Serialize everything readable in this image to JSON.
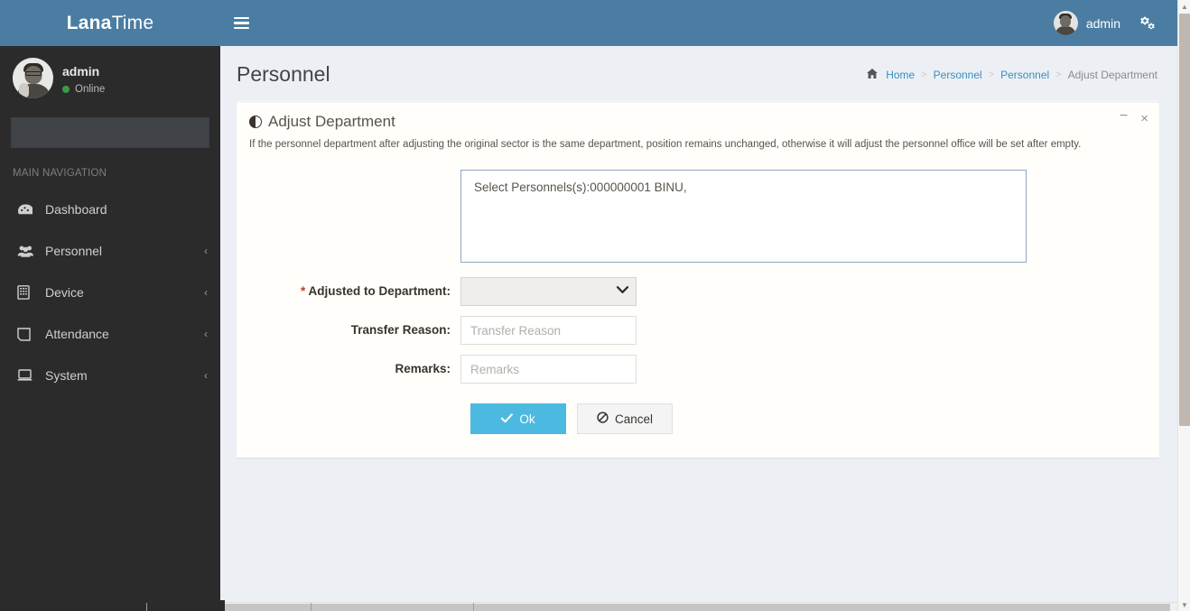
{
  "brand": {
    "bold": "Lana",
    "light": "Time"
  },
  "sidebar": {
    "user": {
      "name": "admin",
      "status": "Online"
    },
    "search": {
      "value": "",
      "placeholder": ""
    },
    "nav_header": "MAIN NAVIGATION",
    "items": [
      {
        "label": "Dashboard",
        "icon": "dashboard-icon",
        "arrow": ""
      },
      {
        "label": "Personnel",
        "icon": "users-icon",
        "arrow": "‹"
      },
      {
        "label": "Device",
        "icon": "device-icon",
        "arrow": "‹"
      },
      {
        "label": "Attendance",
        "icon": "attendance-icon",
        "arrow": "‹"
      },
      {
        "label": "System",
        "icon": "system-icon",
        "arrow": "‹"
      }
    ]
  },
  "navbar": {
    "menu_toggle": "hamburger-icon",
    "user_name": "admin",
    "gear_icon": "gears-icon"
  },
  "content_header": {
    "page_title": "Personnel",
    "breadcrumb": {
      "home_icon": "home-icon",
      "items": [
        "Home",
        "Personnel",
        "Personnel",
        "Adjust Department"
      ],
      "separator": ">"
    }
  },
  "panel": {
    "title": "Adjust Department",
    "title_icon": "adjust-contrast-icon",
    "description": "If the personnel department after adjusting the original sector is the same department, position remains unchanged, otherwise it will adjust the personnel office will be set after empty.",
    "tools": {
      "minimize": "−",
      "close": "×"
    },
    "form": {
      "selected_personnel": {
        "value": "Select Personnels(s):000000001 BINU,",
        "placeholder": ""
      },
      "department": {
        "label": "Adjusted to Department:",
        "required_marker": "*",
        "value": "",
        "options": [
          ""
        ],
        "caret_icon": "chevron-down-icon"
      },
      "transfer_reason": {
        "label": "Transfer Reason:",
        "value": "",
        "placeholder": "Transfer Reason"
      },
      "remarks": {
        "label": "Remarks:",
        "value": "",
        "placeholder": "Remarks"
      },
      "buttons": {
        "ok": {
          "label": "Ok",
          "icon": "check-icon",
          "color": "#4cb9e0"
        },
        "cancel": {
          "label": "Cancel",
          "icon": "ban-icon",
          "color": "#f4f4f4"
        }
      }
    }
  },
  "colors": {
    "brand_blue": "#4b7da3",
    "sidebar_dark": "#2b2b2b",
    "body_bg": "#ecf0f5",
    "accent": "#4cb9e0",
    "online_green": "#3c9c46",
    "required_red": "#c0392b"
  }
}
